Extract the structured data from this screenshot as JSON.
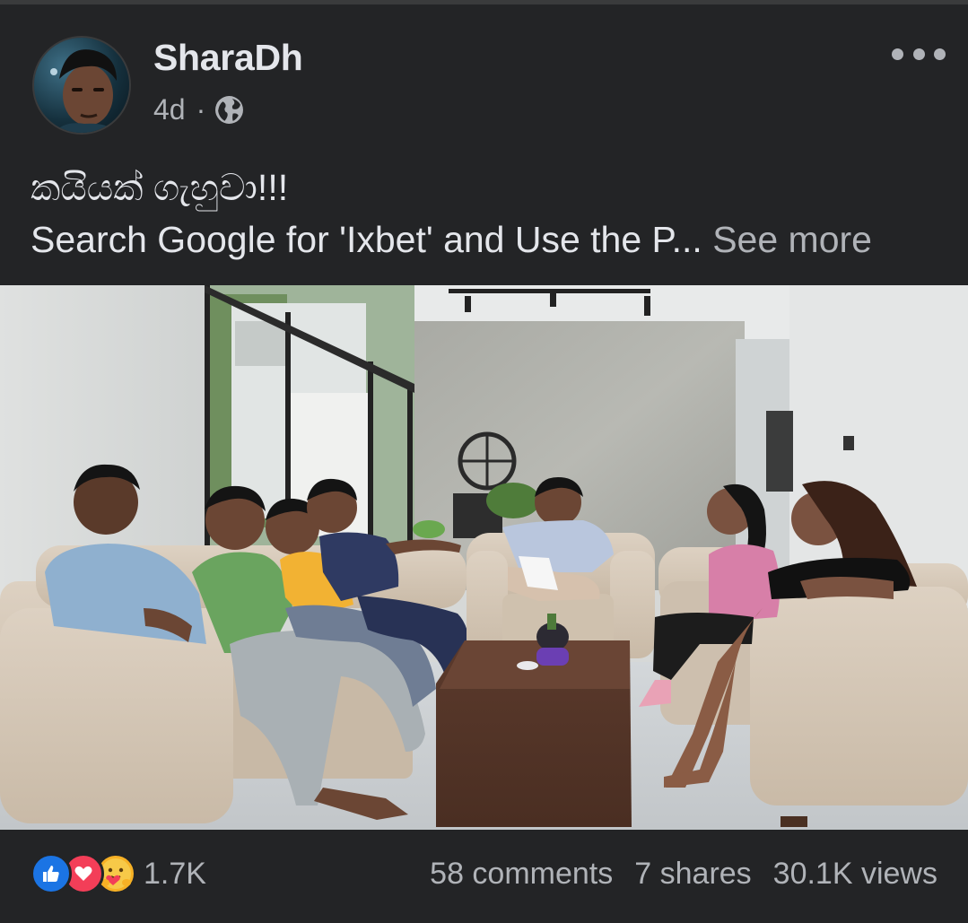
{
  "post": {
    "author": "SharaDh",
    "time": "4d",
    "separator": "·",
    "audience_icon": "globe-icon",
    "menu_icon": "more-options-icon",
    "caption_line1": "කයියක් ගැහුවා!!!",
    "caption_line2": "Search Google for 'Ixbet' and Use the P...",
    "see_more": "See more"
  },
  "footer": {
    "reaction_icons": [
      "like-icon",
      "love-icon",
      "care-icon"
    ],
    "reaction_count": "1.7K",
    "comments": "58 comments",
    "shares": "7 shares",
    "views": "30.1K views"
  },
  "colors": {
    "background": "#232426",
    "primary_text": "#e4e6eb",
    "secondary_text": "#b0b3b8",
    "like": "#1b74e4",
    "love": "#f33e58",
    "care": "#f7b125"
  }
}
